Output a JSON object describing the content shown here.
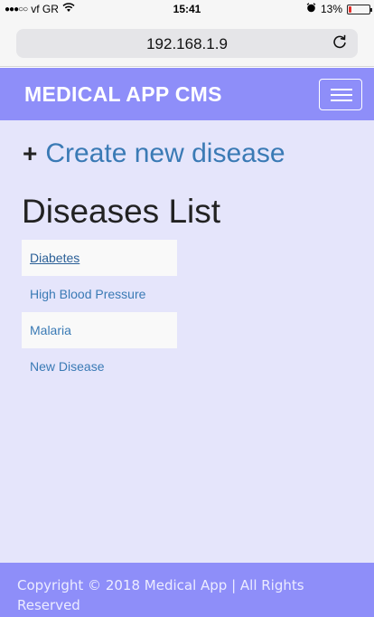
{
  "status_bar": {
    "signal": "●●●○○",
    "carrier": "vf GR",
    "time": "15:41",
    "battery_percent": "13%",
    "battery_level": 0.13
  },
  "browser": {
    "url": "192.168.1.9",
    "reload_symbol": "C"
  },
  "navbar": {
    "brand": "MEDICAL APP CMS"
  },
  "main": {
    "create_link": "Create new disease",
    "list_title": "Diseases List",
    "diseases": [
      {
        "label": "Diabetes"
      },
      {
        "label": "High Blood Pressure"
      },
      {
        "label": "Malaria"
      },
      {
        "label": "New Disease"
      }
    ]
  },
  "footer": {
    "text": "Copyright © 2018 Medical App | All Rights Reserved"
  },
  "colors": {
    "navbar": "#8e8ef9",
    "content_bg": "#e5e5fb",
    "link": "#3a7ab5"
  }
}
